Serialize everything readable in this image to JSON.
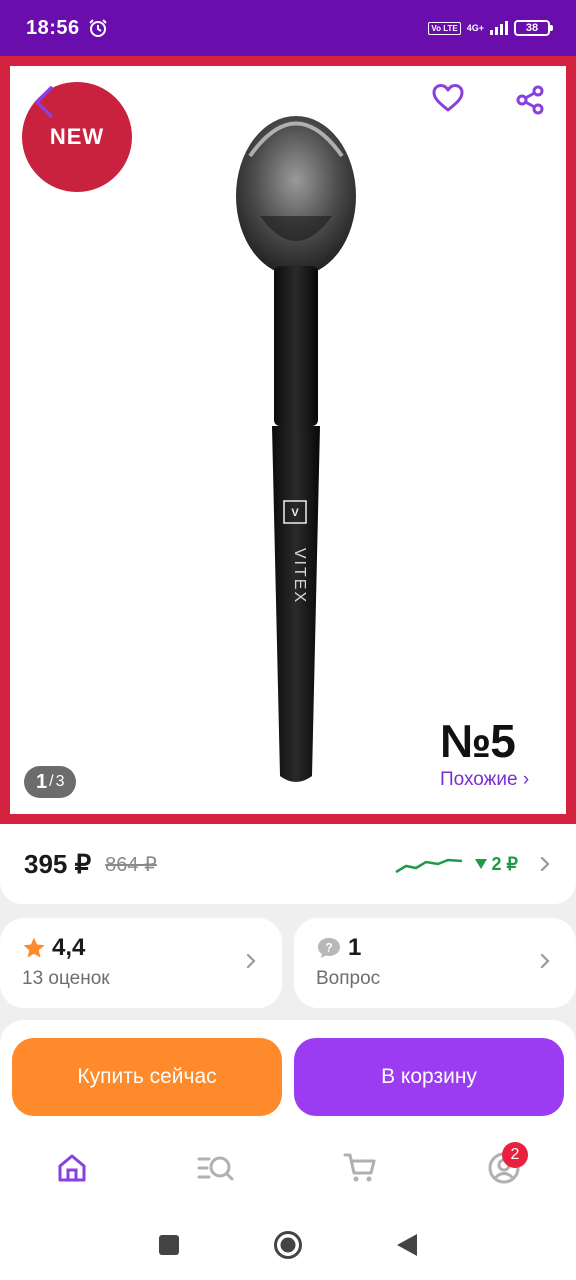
{
  "status_bar": {
    "time": "18:56",
    "volte": "Vo LTE",
    "network": "4G+",
    "battery": "38"
  },
  "gallery": {
    "badge_new": "NEW",
    "product_mark": "№5",
    "page_current": "1",
    "page_separator": "/",
    "page_total": "3",
    "similar_label": "Похожие ›",
    "brand_text": "VITEX"
  },
  "price": {
    "current": "395 ₽",
    "old": "864 ₽",
    "delta": "2 ₽"
  },
  "rating": {
    "value": "4,4",
    "count_label": "13 оценок"
  },
  "questions": {
    "count": "1",
    "label": "Вопрос"
  },
  "actions": {
    "buy_now": "Купить сейчас",
    "add_to_cart": "В корзину"
  },
  "tabbar": {
    "profile_badge": "2"
  },
  "colors": {
    "brand_purple": "#6a0dad",
    "accent_purple": "#9b3cf2",
    "orange": "#ff8a2b",
    "frame_red": "#d3223f",
    "green": "#1e9a4a"
  },
  "icons": [
    "alarm-icon",
    "back-icon",
    "heart-icon",
    "share-icon",
    "star-icon",
    "question-icon",
    "chevron-right-icon",
    "home-icon",
    "catalog-search-icon",
    "cart-icon",
    "profile-icon",
    "nav-recents-icon",
    "nav-home-icon",
    "nav-back-icon"
  ]
}
